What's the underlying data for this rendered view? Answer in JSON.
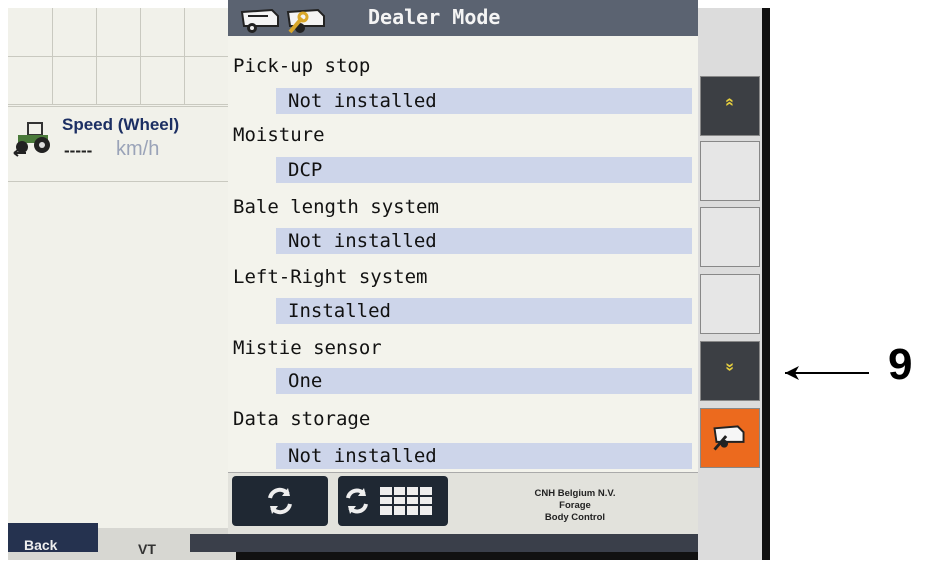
{
  "speed": {
    "title": "Speed (Wheel)",
    "value": "-----",
    "unit": "km/h"
  },
  "header": {
    "title": "Dealer Mode"
  },
  "settings": [
    {
      "label": "Pick-up stop",
      "value": "Not installed"
    },
    {
      "label": "Moisture",
      "value": "DCP"
    },
    {
      "label": "Bale length system",
      "value": "Not installed"
    },
    {
      "label": "Left-Right system",
      "value": "Installed"
    },
    {
      "label": "Mistie sensor",
      "value": "One"
    },
    {
      "label": "Data storage",
      "value": "Not installed"
    }
  ],
  "footer": {
    "company_line1": "CNH Belgium N.V.",
    "company_line2": "Forage",
    "company_line3": "Body Control"
  },
  "tabs": {
    "back": "Back",
    "vt": "VT"
  },
  "softkeys": {
    "up": "»",
    "down": "»"
  },
  "annotation": {
    "number": "9"
  },
  "colors": {
    "header": "#5b6371",
    "value_bg": "#cdd5ea",
    "softkey_orange": "#ec6a1e"
  },
  "icons": [
    "baler-icon",
    "baler-wrench-icon",
    "refresh-icon",
    "keypad-icon",
    "tractor-icon"
  ]
}
